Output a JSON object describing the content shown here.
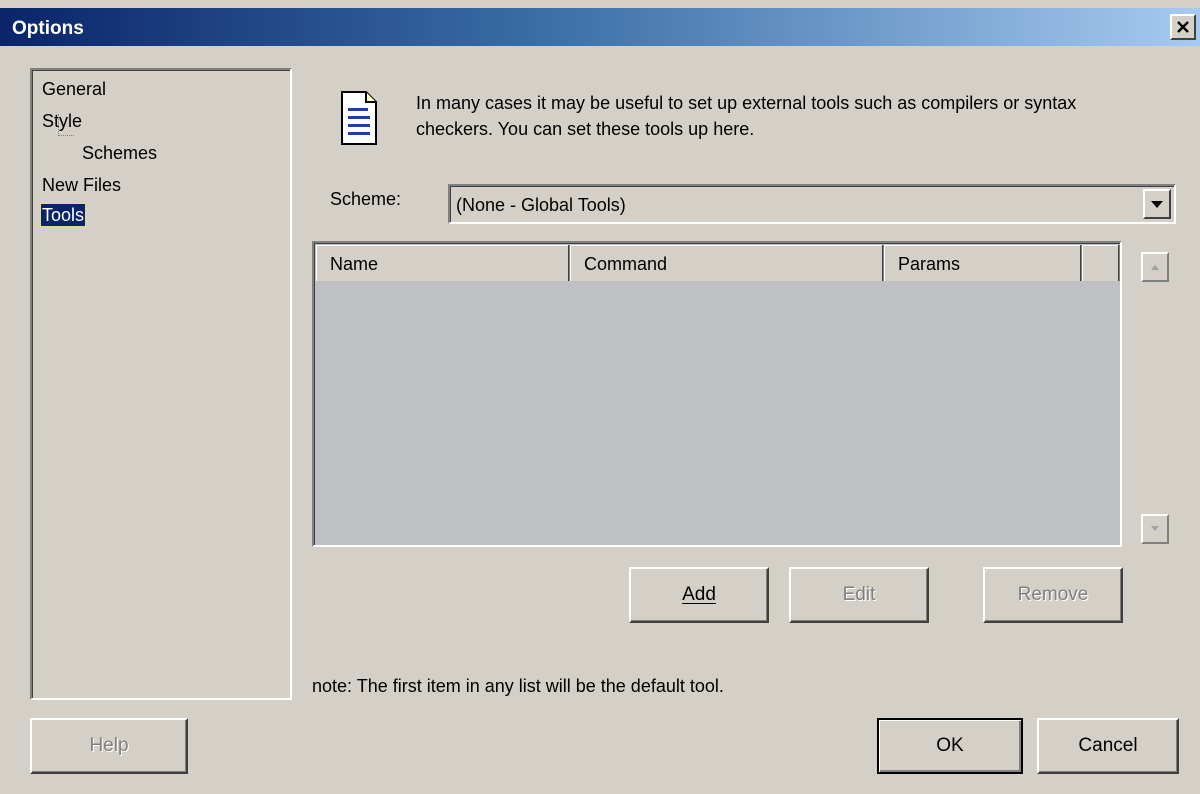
{
  "window": {
    "title": "Options",
    "close_glyph": "×"
  },
  "tree": {
    "items": [
      {
        "label": "General"
      },
      {
        "label": "Style"
      },
      {
        "label": "Schemes"
      },
      {
        "label": "New Files"
      },
      {
        "label": "Tools",
        "selected": true
      }
    ]
  },
  "description": "In many cases it may be useful to set up external tools such as compilers or syntax checkers. You can set these tools up here.",
  "description_icon": "document-icon",
  "scheme": {
    "label": "Scheme:",
    "value": "(None - Global Tools)"
  },
  "list": {
    "columns": [
      "Name",
      "Command",
      "Params"
    ],
    "rows": []
  },
  "buttons": {
    "add": "Add",
    "edit": "Edit",
    "remove": "Remove",
    "help": "Help",
    "ok": "OK",
    "cancel": "Cancel"
  },
  "note": "note: The first item in any list will be the default tool.",
  "colors": {
    "title_start": "#0a246a",
    "title_end": "#a6caf0",
    "face": "#d4d0c8",
    "selection": "#0a246a"
  }
}
